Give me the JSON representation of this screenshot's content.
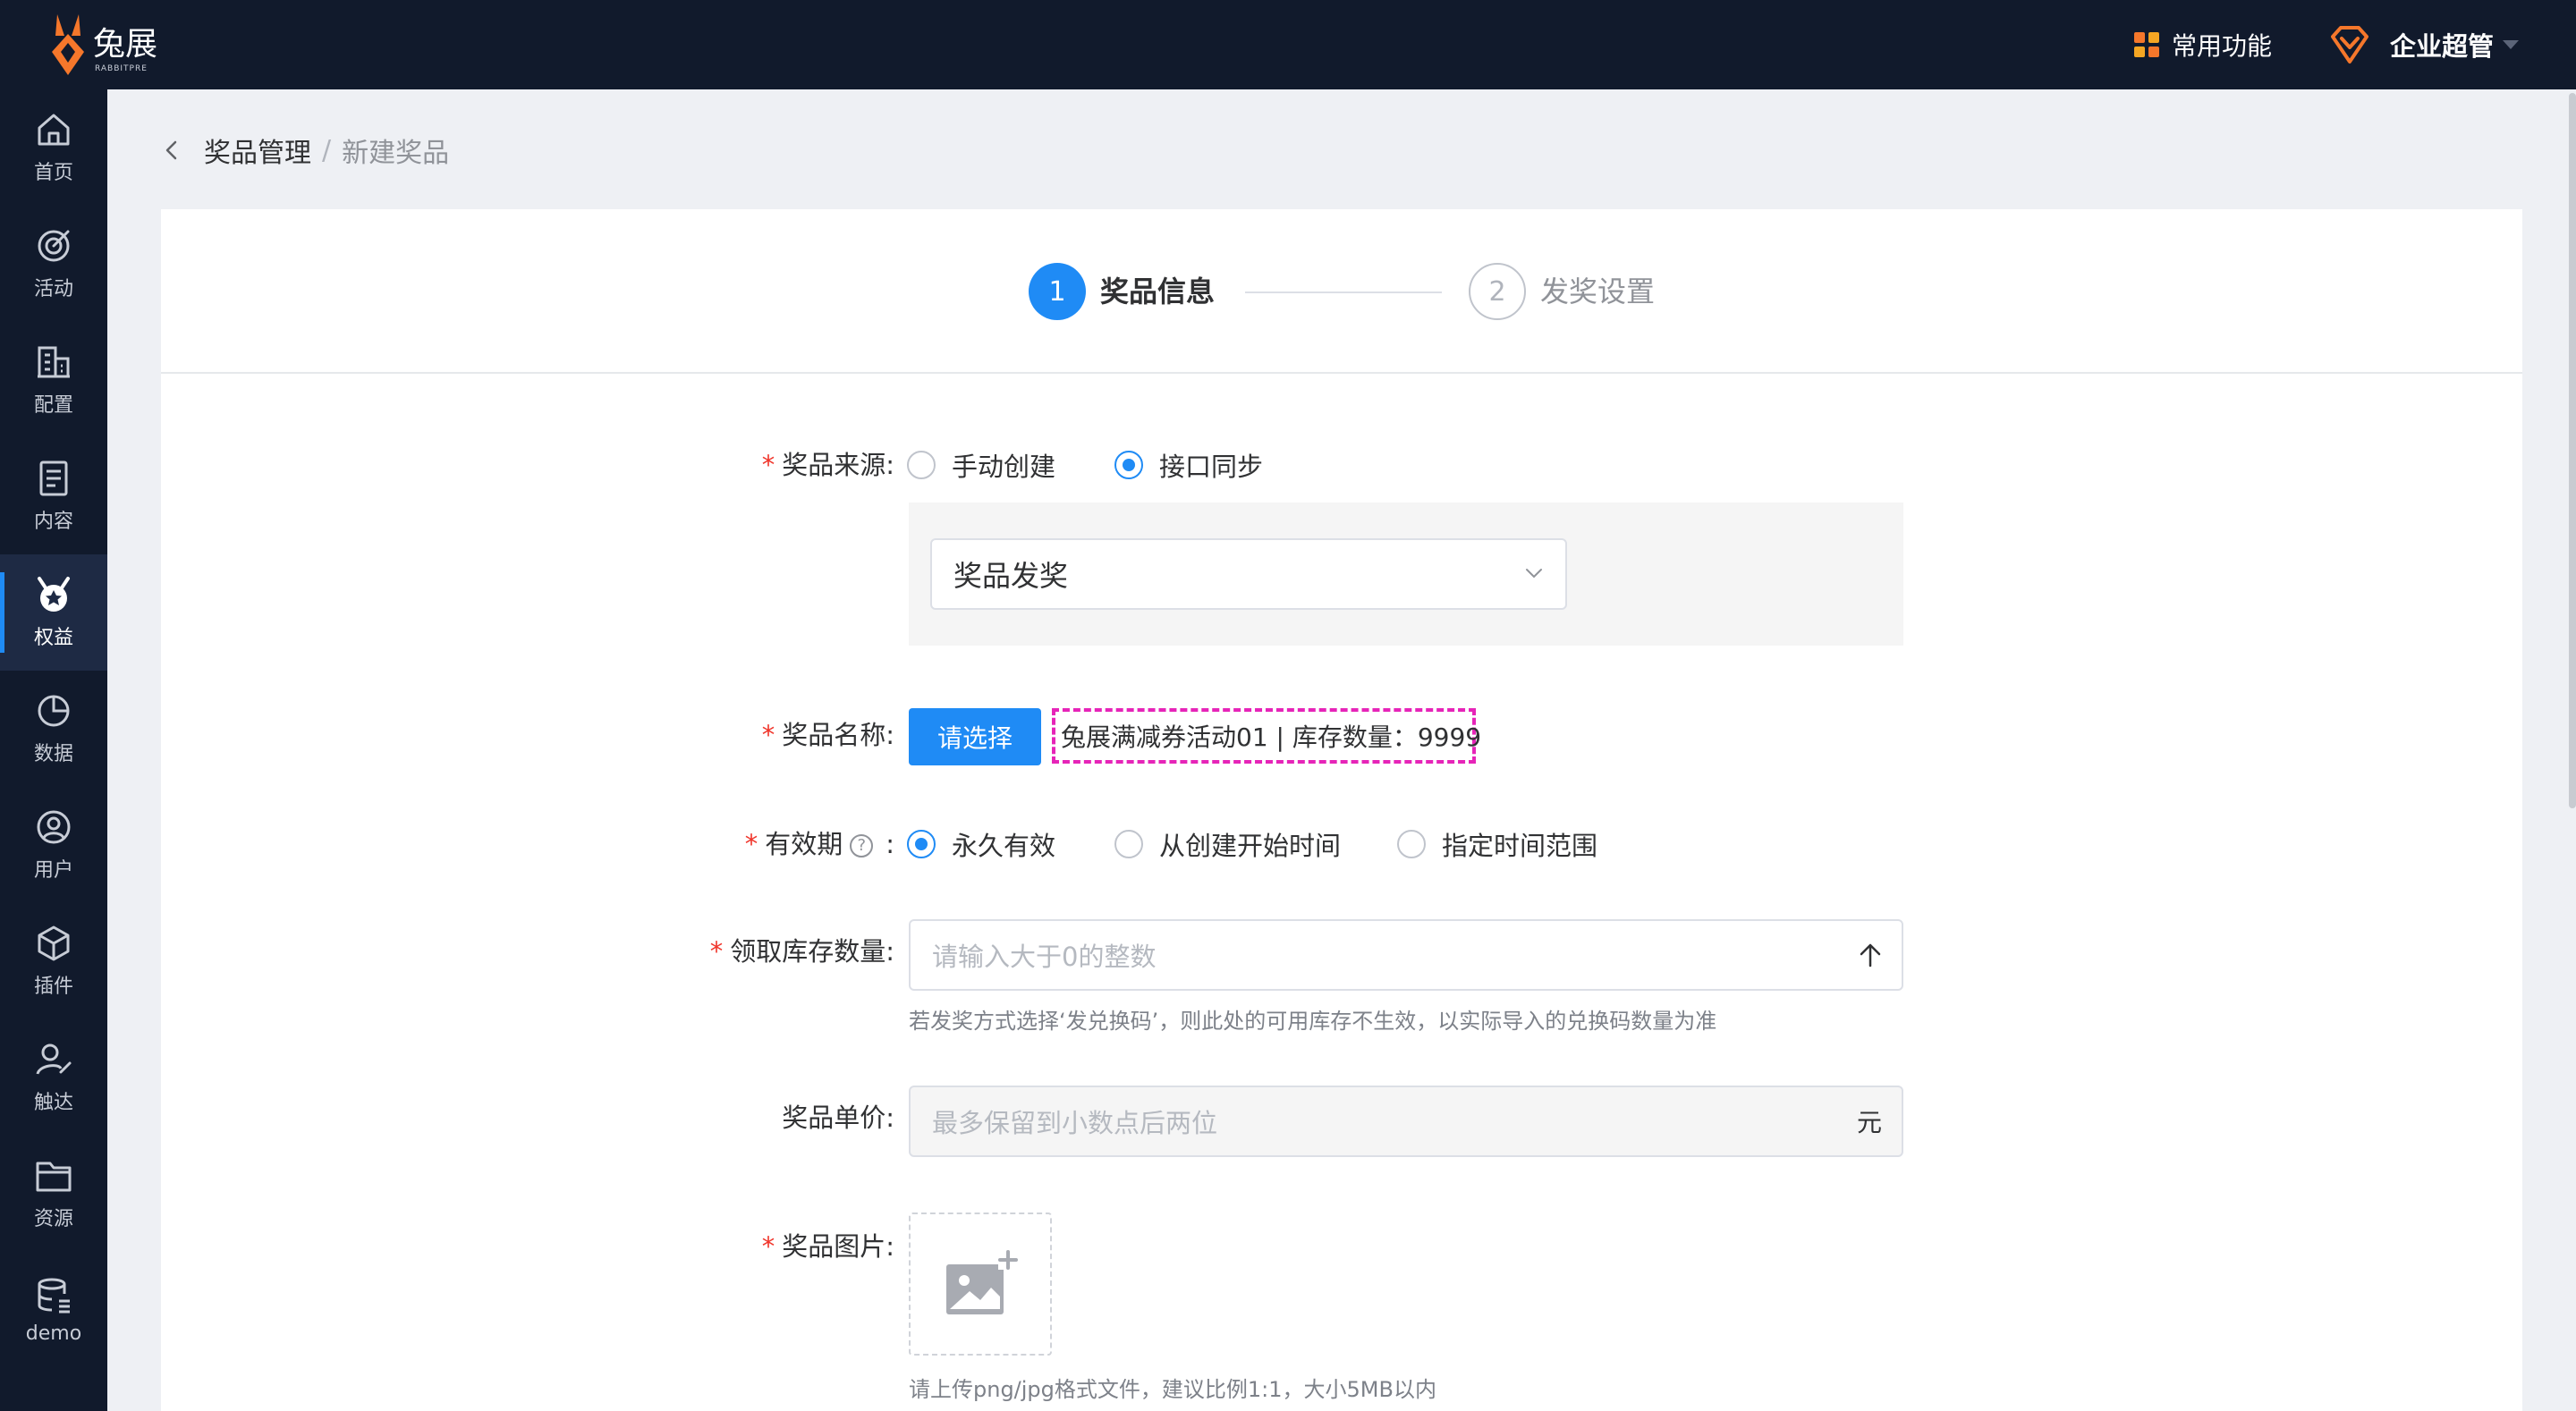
{
  "topbar": {
    "logo_text": "兔展",
    "logo_sub": "RABBITPRE",
    "common_functions": "常用功能",
    "user_role": "企业超管"
  },
  "sidebar": {
    "items": [
      {
        "label": "首页",
        "icon": "home-icon"
      },
      {
        "label": "活动",
        "icon": "target-icon"
      },
      {
        "label": "配置",
        "icon": "building-icon"
      },
      {
        "label": "内容",
        "icon": "document-icon"
      },
      {
        "label": "权益",
        "icon": "medal-icon",
        "active": true
      },
      {
        "label": "数据",
        "icon": "pie-chart-icon"
      },
      {
        "label": "用户",
        "icon": "user-circle-icon"
      },
      {
        "label": "插件",
        "icon": "cube-icon"
      },
      {
        "label": "触达",
        "icon": "user-reach-icon"
      },
      {
        "label": "资源",
        "icon": "folder-icon"
      },
      {
        "label": "demo",
        "icon": "database-icon"
      }
    ]
  },
  "breadcrumb": {
    "parent": "奖品管理",
    "separator": "/",
    "current": "新建奖品"
  },
  "steps": [
    {
      "number": "1",
      "label": "奖品信息",
      "active": true
    },
    {
      "number": "2",
      "label": "发奖设置",
      "active": false
    }
  ],
  "form": {
    "source": {
      "label": "奖品来源:",
      "options": [
        "手动创建",
        "接口同步"
      ],
      "selected": "接口同步",
      "select_value": "奖品发奖"
    },
    "name": {
      "label": "奖品名称:",
      "button": "请选择",
      "selected_text": "兔展满减券活动01 | 库存数量：9999"
    },
    "validity": {
      "label": "有效期",
      "help": "?",
      "colon": ":",
      "options": [
        "永久有效",
        "从创建开始时间",
        "指定时间范围"
      ],
      "selected": "永久有效"
    },
    "stock": {
      "label": "领取库存数量:",
      "placeholder": "请输入大于0的整数",
      "hint": "若发奖方式选择‘发兑换码’，则此处的可用库存不生效，以实际导入的兑换码数量为准"
    },
    "price": {
      "label": "奖品单价:",
      "placeholder": "最多保留到小数点后两位",
      "suffix": "元"
    },
    "image": {
      "label": "奖品图片:",
      "hint": "请上传png/jpg格式文件，建议比例1:1，大小5MB以内"
    }
  },
  "colors": {
    "primary": "#1f8bf5",
    "nav_bg": "#111a2c",
    "required": "#f0352b",
    "highlight_border": "#e624b8",
    "brand_orange": "#f5772b"
  }
}
